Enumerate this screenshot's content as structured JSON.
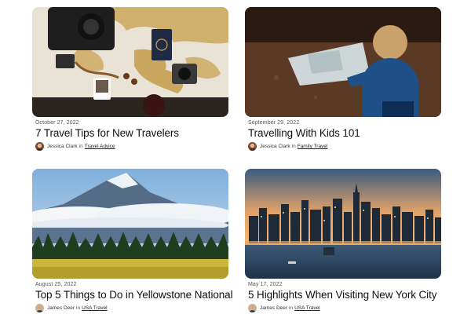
{
  "posts": [
    {
      "date": "October 27, 2022",
      "title": "7 Travel Tips for New Travelers",
      "author": "Jessica Clark",
      "in": "in",
      "category": "Travel Advice",
      "image": "map-camera-passport-photo"
    },
    {
      "date": "September 29, 2022",
      "title": "Travelling With Kids 101",
      "author": "Jessica Clark",
      "in": "in",
      "category": "Family Travel",
      "image": "child-reading-map-photo"
    },
    {
      "date": "August 25, 2022",
      "title": "Top 5 Things to Do in Yellowstone National",
      "author": "James Deer",
      "in": "in",
      "category": "USA Travel",
      "image": "mountain-forest-photo"
    },
    {
      "date": "May 17, 2022",
      "title": "5 Highlights When Visiting New York City",
      "author": "James Deer",
      "in": "in",
      "category": "USA Travel",
      "image": "city-skyline-photo"
    }
  ]
}
